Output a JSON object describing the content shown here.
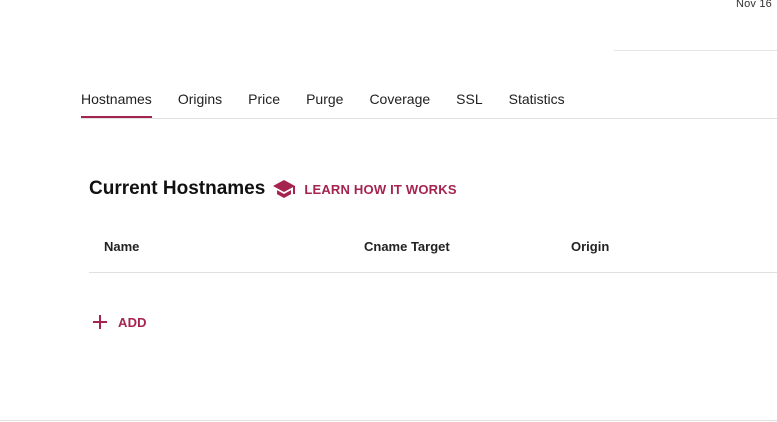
{
  "header": {
    "date_text": "Nov 16"
  },
  "tabs": [
    {
      "label": "Hostnames",
      "active": true
    },
    {
      "label": "Origins",
      "active": false
    },
    {
      "label": "Price",
      "active": false
    },
    {
      "label": "Purge",
      "active": false
    },
    {
      "label": "Coverage",
      "active": false
    },
    {
      "label": "SSL",
      "active": false
    },
    {
      "label": "Statistics",
      "active": false
    }
  ],
  "section": {
    "title": "Current Hostnames",
    "learn_icon": "graduation-cap-icon",
    "learn_link_label": "LEARN HOW IT WORKS"
  },
  "table": {
    "columns": [
      "Name",
      "Cname Target",
      "Origin"
    ],
    "rows": []
  },
  "actions": {
    "add_icon": "plus-icon",
    "add_label": "ADD"
  },
  "colors": {
    "accent": "#a5244f",
    "divider": "#e0e0e0",
    "text": "#212121"
  }
}
